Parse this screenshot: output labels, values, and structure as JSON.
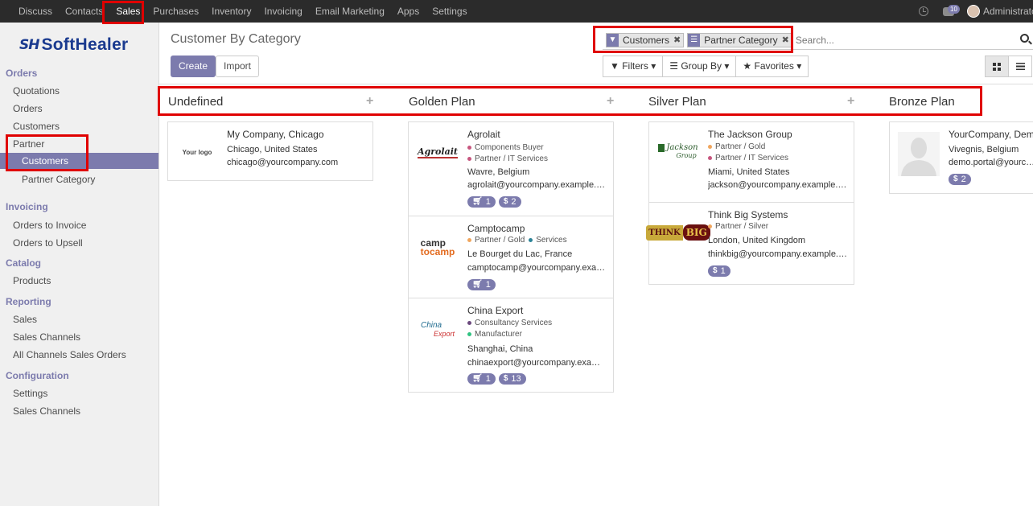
{
  "topbar": {
    "menu": [
      "Discuss",
      "Contacts",
      "Sales",
      "Purchases",
      "Inventory",
      "Invoicing",
      "Email Marketing",
      "Apps",
      "Settings"
    ],
    "active": "Sales",
    "chat_count": "10",
    "user": "Administrator"
  },
  "sidebar": {
    "logo_mark": "SH",
    "logo_word": "SoftHealer",
    "orders": {
      "title": "Orders",
      "items": [
        "Quotations",
        "Orders",
        "Customers"
      ]
    },
    "partner": {
      "title": "Partner",
      "items": [
        "Customers",
        "Partner Category"
      ]
    },
    "invoicing": {
      "title": "Invoicing",
      "items": [
        "Orders to Invoice",
        "Orders to Upsell"
      ]
    },
    "catalog": {
      "title": "Catalog",
      "items": [
        "Products"
      ]
    },
    "reporting": {
      "title": "Reporting",
      "items": [
        "Sales",
        "Sales Channels",
        "All Channels Sales Orders"
      ]
    },
    "configuration": {
      "title": "Configuration",
      "items": [
        "Settings",
        "Sales Channels"
      ]
    }
  },
  "control": {
    "breadcrumb": "Customer By Category",
    "create": "Create",
    "import": "Import",
    "facets": [
      "Customers",
      "Partner Category"
    ],
    "search_placeholder": "Search...",
    "filters": "Filters",
    "group_by": "Group By",
    "favorites": "Favorites"
  },
  "columns": [
    {
      "title": "Undefined",
      "cards": [
        {
          "logo": "Your logo",
          "name": "My Company, Chicago",
          "address": "Chicago, United States",
          "email": "chicago@yourcompany.com"
        }
      ]
    },
    {
      "title": "Golden Plan",
      "cards": [
        {
          "logo": "Agrolait",
          "name": "Agrolait",
          "tags": [
            "Components Buyer",
            "Partner / IT Services"
          ],
          "address": "Wavre, Belgium",
          "email": "agrolait@yourcompany.example.com",
          "orders": "1",
          "invoices": "2"
        },
        {
          "logo_a": "camp",
          "logo_b": "tocamp",
          "name": "Camptocamp",
          "tags": [
            "Partner / Gold",
            "Services"
          ],
          "address": "Le Bourget du Lac, France",
          "email": "camptocamp@yourcompany.example.com",
          "orders": "1"
        },
        {
          "logo_a": "China",
          "logo_b": "Export",
          "name": "China Export",
          "tags": [
            "Consultancy Services",
            "Manufacturer"
          ],
          "address": "Shanghai, China",
          "email": "chinaexport@yourcompany.example.com",
          "orders": "1",
          "invoices": "13"
        }
      ]
    },
    {
      "title": "Silver Plan",
      "cards": [
        {
          "logo_a": "Jackson",
          "logo_b": "Group",
          "name": "The Jackson Group",
          "tags": [
            "Partner / Gold",
            "Partner / IT Services"
          ],
          "address": "Miami, United States",
          "email": "jackson@yourcompany.example.com"
        },
        {
          "logo_a": "THINK",
          "logo_b": "BIG",
          "name": "Think Big Systems",
          "tags": [
            "Partner / Silver"
          ],
          "address": "London, United Kingdom",
          "email": "thinkbig@yourcompany.example.com",
          "invoices": "1"
        }
      ]
    },
    {
      "title": "Bronze Plan",
      "cards": [
        {
          "name": "YourCompany, Demo Portal User",
          "address": "Vivegnis, Belgium",
          "email": "demo.portal@yourcompany.example.com",
          "invoices": "2"
        }
      ]
    }
  ],
  "tag_colors": {
    "pink": "#c7567f",
    "orange": "#f0a65e",
    "teal": "#2c8397",
    "purple": "#6c4a7e",
    "green": "#30c381"
  },
  "highlight_color": "#e00000",
  "accent": "#7c7bad"
}
